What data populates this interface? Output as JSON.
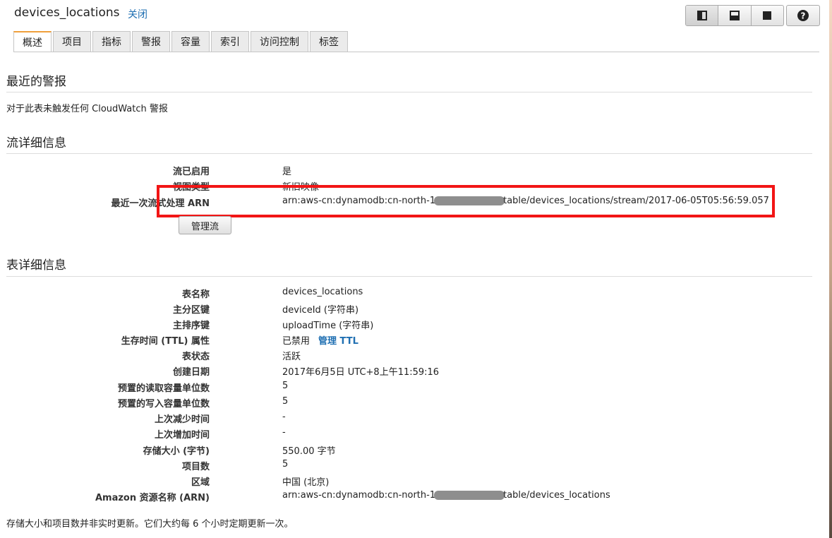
{
  "header": {
    "title": "devices_locations",
    "close_label": "关闭",
    "layout_buttons": [
      "layout-split-vertical-icon",
      "layout-split-horizontal-icon",
      "layout-full-icon"
    ],
    "help_icon": "help-icon"
  },
  "tabs": [
    {
      "label": "概述",
      "active": true
    },
    {
      "label": "项目"
    },
    {
      "label": "指标"
    },
    {
      "label": "警报"
    },
    {
      "label": "容量"
    },
    {
      "label": "索引"
    },
    {
      "label": "访问控制"
    },
    {
      "label": "标签"
    }
  ],
  "alarms": {
    "heading": "最近的警报",
    "message": "对于此表未触发任何 CloudWatch 警报"
  },
  "stream": {
    "heading": "流详细信息",
    "enabled_label": "流已启用",
    "enabled_value": "是",
    "view_type_label": "视图类型",
    "view_type_value": "新旧映像",
    "arn_label": "最近一次流式处理 ARN",
    "arn_prefix": "arn:aws-cn:dynamodb:cn-north-1",
    "arn_suffix": "table/devices_locations/stream/2017-06-05T05:56:59.057",
    "manage_button": "管理流"
  },
  "table": {
    "heading": "表详细信息",
    "rows": [
      {
        "label": "表名称",
        "value": "devices_locations"
      },
      {
        "label": "主分区键",
        "value": "deviceId (字符串)"
      },
      {
        "label": "主排序键",
        "value": "uploadTime (字符串)"
      },
      {
        "label": "生存时间 (TTL) 属性",
        "value": "已禁用",
        "link": "管理 TTL"
      },
      {
        "label": "表状态",
        "value": "活跃"
      },
      {
        "label": "创建日期",
        "value": "2017年6月5日 UTC+8上午11:59:16"
      },
      {
        "label": "预置的读取容量单位数",
        "value": "5"
      },
      {
        "label": "预置的写入容量单位数",
        "value": "5"
      },
      {
        "label": "上次减少时间",
        "value": "-"
      },
      {
        "label": "上次增加时间",
        "value": "-"
      },
      {
        "label": "存储大小 (字节)",
        "value": "550.00 字节"
      },
      {
        "label": "项目数",
        "value": "5"
      },
      {
        "label": "区域",
        "value": "中国 (北京)"
      },
      {
        "label": "Amazon 资源名称 (ARN)",
        "arn_prefix": "arn:aws-cn:dynamodb:cn-north-1",
        "arn_suffix": "table/devices_locations"
      }
    ],
    "footnote": "存储大小和项目数并非实时更新。它们大约每 6 个小时定期更新一次。"
  },
  "colors": {
    "link": "#1f6fb2",
    "highlight": "#f21515",
    "tab_accent": "#f0a03c"
  }
}
